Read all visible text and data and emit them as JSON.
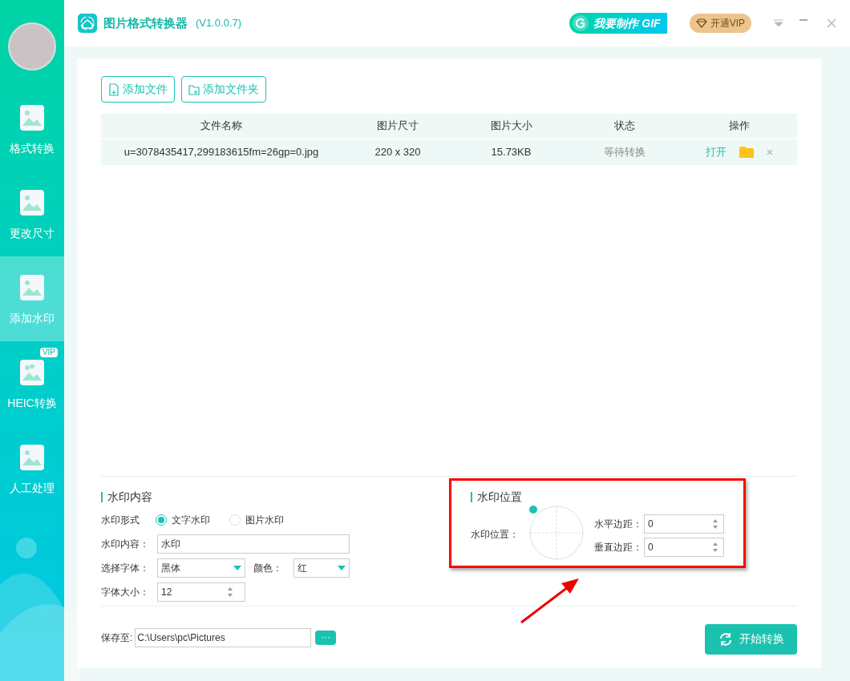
{
  "app": {
    "title": "图片格式转换器",
    "version": "(V1.0.0.7)"
  },
  "header": {
    "gif_button": "我要制作 GIF",
    "vip_button": "开通VIP"
  },
  "sidebar": {
    "items": [
      {
        "label": "格式转换",
        "selected": false
      },
      {
        "label": "更改尺寸",
        "selected": false
      },
      {
        "label": "添加水印",
        "selected": true
      },
      {
        "label": "HEIC转换",
        "selected": false,
        "badge": "VIP"
      },
      {
        "label": "人工处理",
        "selected": false
      }
    ]
  },
  "toolbar": [
    "添加文件",
    "添加文件夹"
  ],
  "table": {
    "columns": [
      "文件名称",
      "图片尺寸",
      "图片大小",
      "状态",
      "操作"
    ],
    "rows": [
      {
        "name": "u=3078435417,299183615fm=26gp=0.jpg",
        "dimensions": "220 x 320",
        "size": "15.73KB",
        "status": "等待转换",
        "open": "打开"
      }
    ]
  },
  "watermark_content": {
    "title": "水印内容",
    "type_label": "水印形式",
    "types": [
      {
        "label": "文字水印",
        "selected": true
      },
      {
        "label": "图片水印",
        "selected": false
      }
    ],
    "content_label": "水印内容：",
    "content_value": "水印",
    "font_label": "选择字体：",
    "font_value": "黑体",
    "color_label": "颜色：",
    "color_value": "红",
    "size_label": "字体大小：",
    "size_value": "12"
  },
  "watermark_position": {
    "title": "水印位置",
    "position_label": "水印位置：",
    "marker_top_left": true,
    "h_label": "水平边距：",
    "h_value": "0",
    "v_label": "垂直边距：",
    "v_value": "0"
  },
  "save": {
    "label": "保存至:",
    "path": "C:\\Users\\pc\\Pictures",
    "browse": "···"
  },
  "start_button": "开始转换"
}
